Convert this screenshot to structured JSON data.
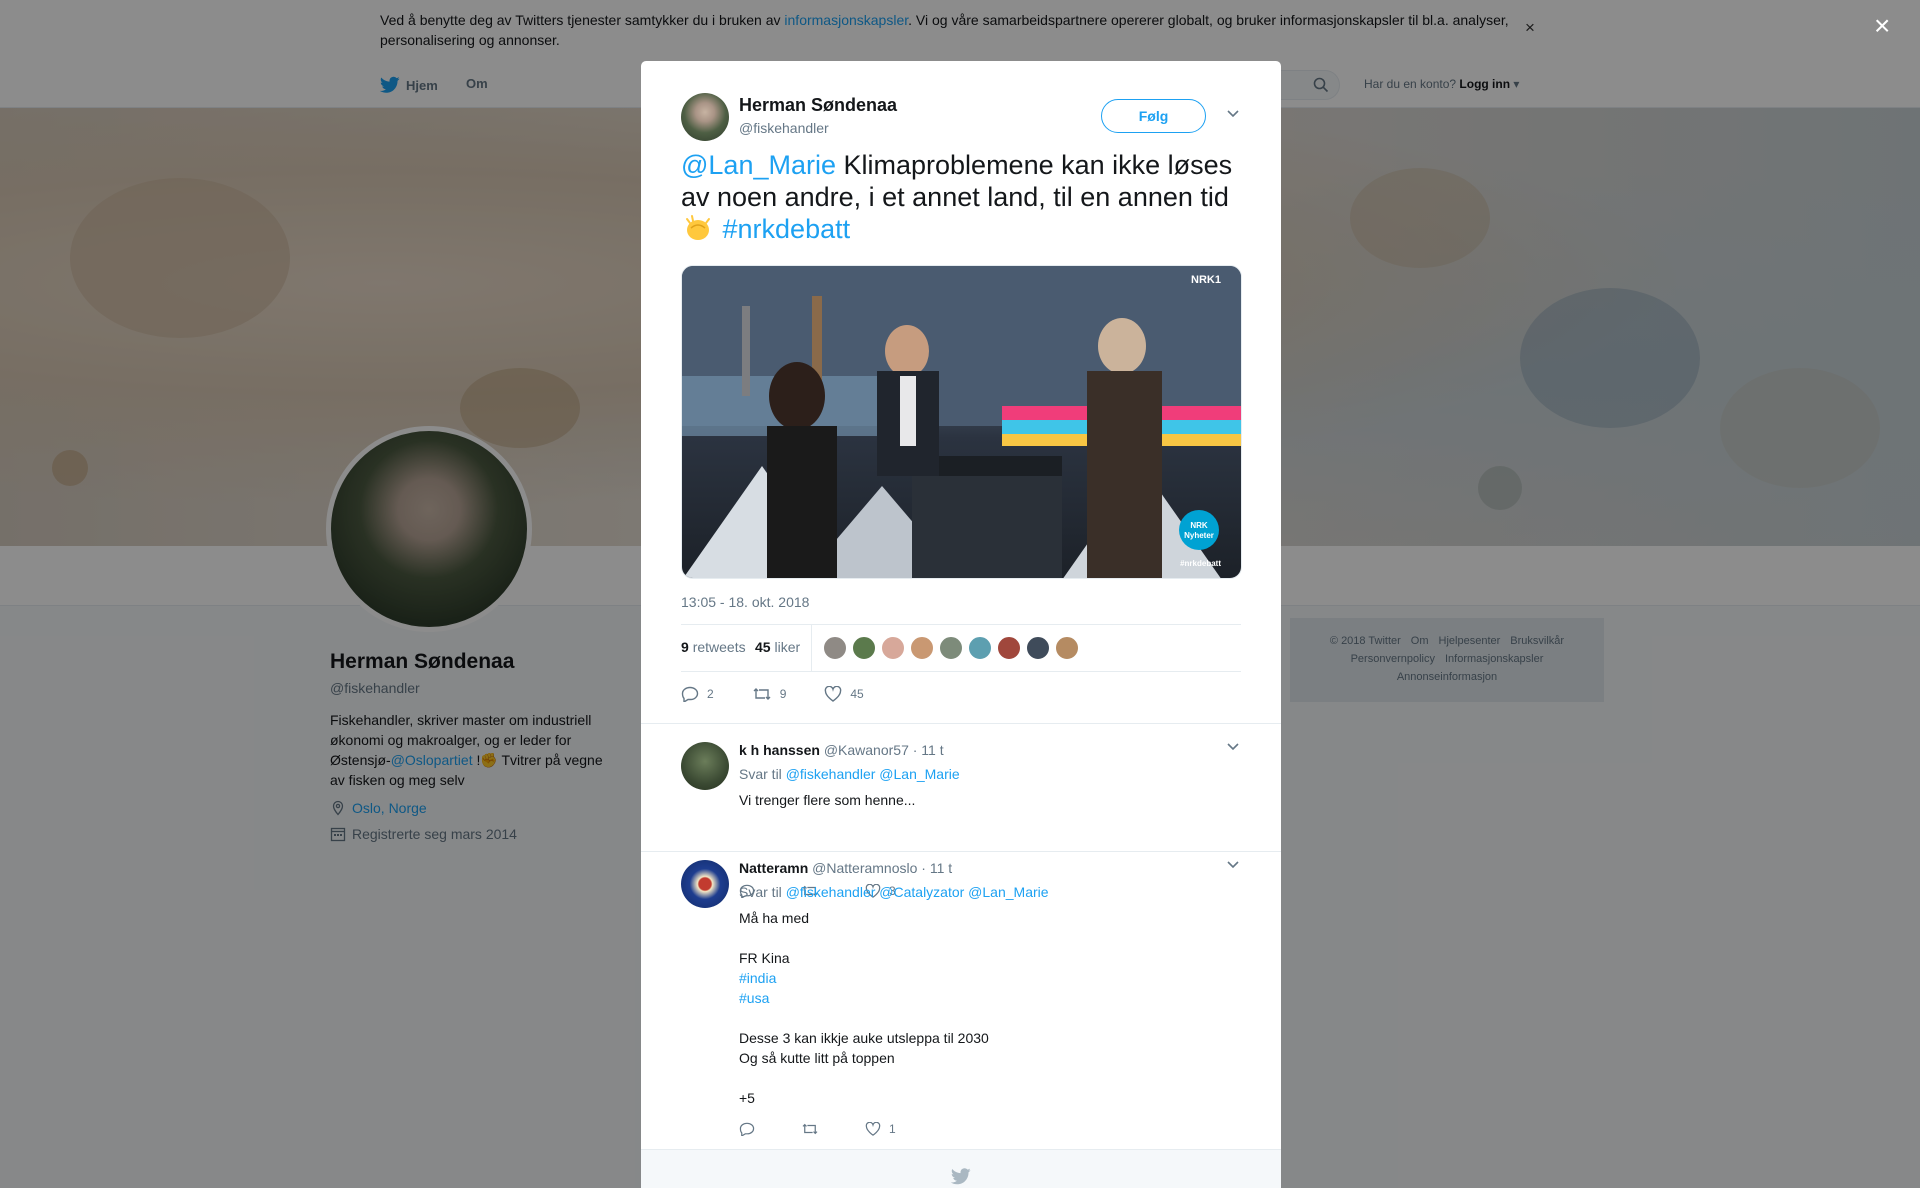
{
  "cookie": {
    "text_before": "Ved å benytte deg av Twitters tjenester samtykker du i bruken av ",
    "link": "informasjonskapsler",
    "text_after": ". Vi og våre samarbeidspartnere opererer globalt, og bruker informasjonskapsler til bl.a. analyser, personalisering og annonser.",
    "close": "×"
  },
  "nav": {
    "home": "Hjem",
    "about": "Om",
    "account_question": "Har du en konto?",
    "login": "Logg inn"
  },
  "profile": {
    "name": "Herman Søndenaa",
    "handle": "@fiskehandler",
    "bio_part1": "Fiskehandler, skriver master om industriell økonomi og makroalger, og er leder for Østensjø-",
    "bio_link": "@Oslopartiet",
    "bio_part2": " !✊ Tvitrer på vegne av fisken og meg selv",
    "location": "Oslo, Norge",
    "joined": "Registrerte seg mars 2014"
  },
  "footer": {
    "items": [
      "© 2018 Twitter",
      "Om",
      "Hjelpesenter",
      "Bruksvilkår",
      "Personvernpolicy",
      "Informasjonskapsler",
      "Annonseinformasjon"
    ]
  },
  "overlay_close": "×",
  "tweet": {
    "name": "Herman Søndenaa",
    "handle": "@fiskehandler",
    "follow": "Følg",
    "mention": "@Lan_Marie",
    "text": " Klimaproblemene kan ikke løses av noen andre, i et annet land, til en annen tid ",
    "hashtag": "#nrkdebatt",
    "media_brand": "NRK1",
    "media_badge": "NRK Nyheter",
    "media_tag": "#nrkdebatt",
    "timestamp": "13:05 - 18. okt. 2018",
    "retweets_count": "9",
    "retweets_label": "retweets",
    "likes_count": "45",
    "likes_label": "liker",
    "reply_count": "2",
    "retweet_action_count": "9",
    "like_action_count": "45"
  },
  "replies": [
    {
      "name": "k h hanssen",
      "handle": "@Kawanor57",
      "time": "· 11 t",
      "reply_to_label": "Svar til",
      "reply_to": "@fiskehandler @Lan_Marie",
      "body": "Vi trenger flere som henne...",
      "replies": "",
      "retweets": "",
      "likes": "3"
    },
    {
      "name": "Natteramn",
      "handle": "@Natteramnoslo",
      "time": "· 11 t",
      "reply_to_label": "Svar til",
      "reply_to": "@fiskehandler @Catalyzator @Lan_Marie",
      "body_1": "Må ha med\n\nFR Kina",
      "tag_1": "#india",
      "tag_2": "#usa",
      "body_2": "\nDesse 3 kan ikkje auke utsleppa til 2030\nOg så kutte litt på toppen\n\n+5",
      "replies": "",
      "retweets": "",
      "likes": "1"
    }
  ],
  "colors": {
    "accent": "#1da1f2",
    "text": "#14171a",
    "muted": "#657786",
    "border": "#e6ecf0"
  }
}
